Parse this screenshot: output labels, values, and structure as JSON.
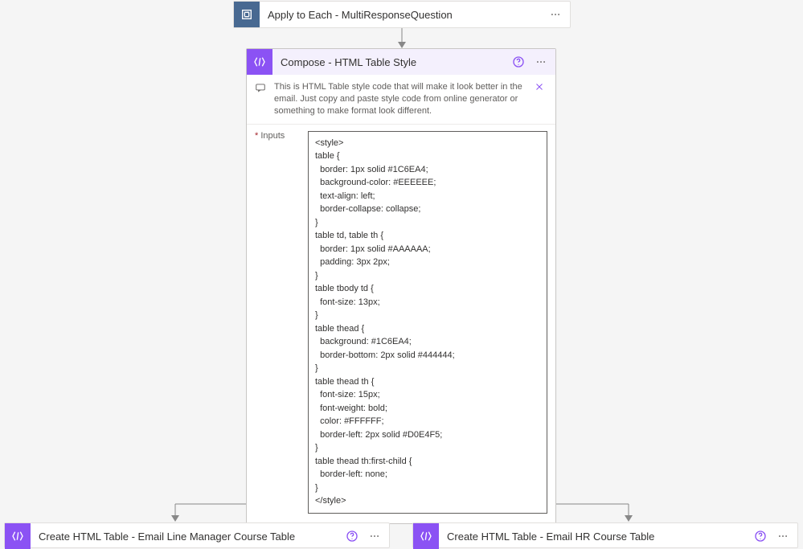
{
  "loopCard": {
    "title": "Apply to Each - MultiResponseQuestion"
  },
  "composeCard": {
    "title": "Compose - HTML Table Style",
    "note": "This is HTML Table style code that will make it look better in the email. Just copy and paste style code from online generator or something to make format look different.",
    "inputsLabel": "Inputs",
    "code": "<style>\ntable {\n  border: 1px solid #1C6EA4;\n  background-color: #EEEEEE;\n  text-align: left;\n  border-collapse: collapse;\n}\ntable td, table th {\n  border: 1px solid #AAAAAA;\n  padding: 3px 2px;\n}\ntable tbody td {\n  font-size: 13px;\n}\ntable thead {\n  background: #1C6EA4;\n  border-bottom: 2px solid #444444;\n}\ntable thead th {\n  font-size: 15px;\n  font-weight: bold;\n  color: #FFFFFF;\n  border-left: 2px solid #D0E4F5;\n}\ntable thead th:first-child {\n  border-left: none;\n}\n</style>"
  },
  "leftCard": {
    "title": "Create HTML Table - Email Line Manager Course Table"
  },
  "rightCard": {
    "title": "Create HTML Table - Email HR Course Table"
  }
}
